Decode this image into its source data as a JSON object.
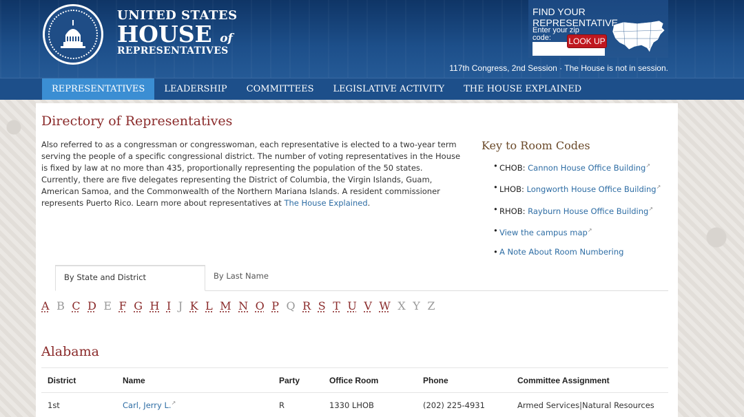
{
  "header": {
    "logo_line1": "UNITED STATES",
    "logo_line2": "HOUSE",
    "logo_of": "of",
    "logo_line3": "REPRESENTATIVES",
    "find_title": "FIND YOUR REPRESENTATIVE",
    "zip_label": "Enter your zip code:",
    "zip_value": "",
    "lookup_label": "LOOK UP",
    "session": "117th Congress, 2nd Session · The House is not in session."
  },
  "nav": {
    "items": [
      {
        "label": "REPRESENTATIVES",
        "active": true
      },
      {
        "label": "LEADERSHIP",
        "active": false
      },
      {
        "label": "COMMITTEES",
        "active": false
      },
      {
        "label": "LEGISLATIVE ACTIVITY",
        "active": false
      },
      {
        "label": "THE HOUSE EXPLAINED",
        "active": false
      }
    ]
  },
  "main": {
    "title": "Directory of Representatives",
    "intro_text": "Also referred to as a congressman or congresswoman, each representative is elected to a two-year term serving the people of a specific congressional district. The number of voting representatives in the House is fixed by law at no more than 435, proportionally representing the population of the 50 states. Currently, there are five delegates representing the District of Columbia, the Virgin Islands, Guam, American Samoa, and the Commonwealth of the Northern Mariana Islands. A resident commissioner represents Puerto Rico. Learn more about representatives at ",
    "intro_link": "The House Explained",
    "intro_end": "."
  },
  "key": {
    "title": "Key to Room Codes",
    "items": [
      {
        "code": "CHOB:",
        "link": "Cannon House Office Building"
      },
      {
        "code": "LHOB:",
        "link": "Longworth House Office Building"
      },
      {
        "code": "RHOB:",
        "link": "Rayburn House Office Building"
      },
      {
        "code": "",
        "link": "View the campus map"
      },
      {
        "code": "",
        "link": "A Note About Room Numbering"
      }
    ]
  },
  "tabs": [
    {
      "label": "By State and District",
      "active": true
    },
    {
      "label": "By Last Name",
      "active": false
    }
  ],
  "alphabet": [
    {
      "l": "A",
      "on": true
    },
    {
      "l": "B",
      "on": false
    },
    {
      "l": "C",
      "on": true
    },
    {
      "l": "D",
      "on": true
    },
    {
      "l": "E",
      "on": false
    },
    {
      "l": "F",
      "on": true
    },
    {
      "l": "G",
      "on": true
    },
    {
      "l": "H",
      "on": true
    },
    {
      "l": "I",
      "on": true
    },
    {
      "l": "J",
      "on": false
    },
    {
      "l": "K",
      "on": true
    },
    {
      "l": "L",
      "on": true
    },
    {
      "l": "M",
      "on": true
    },
    {
      "l": "N",
      "on": true
    },
    {
      "l": "O",
      "on": true
    },
    {
      "l": "P",
      "on": true
    },
    {
      "l": "Q",
      "on": false
    },
    {
      "l": "R",
      "on": true
    },
    {
      "l": "S",
      "on": true
    },
    {
      "l": "T",
      "on": true
    },
    {
      "l": "U",
      "on": true
    },
    {
      "l": "V",
      "on": true
    },
    {
      "l": "W",
      "on": true
    },
    {
      "l": "X",
      "on": false
    },
    {
      "l": "Y",
      "on": false
    },
    {
      "l": "Z",
      "on": false
    }
  ],
  "state": {
    "name": "Alabama",
    "columns": [
      "District",
      "Name",
      "Party",
      "Office Room",
      "Phone",
      "Committee Assignment"
    ],
    "rows": [
      [
        "1st",
        "Carl, Jerry L.",
        "R",
        "1330 LHOB",
        "(202) 225-4931",
        "Armed Services|Natural Resources"
      ]
    ]
  },
  "colors": {
    "brand_blue": "#1d4f8a",
    "active_tab": "#3b8ed3",
    "title_red": "#8a2a2a",
    "link": "#2e6da4",
    "lookup_red": "#c0181f"
  },
  "icons": [
    "capitol-seal-icon",
    "us-map-icon",
    "external-link-icon"
  ]
}
